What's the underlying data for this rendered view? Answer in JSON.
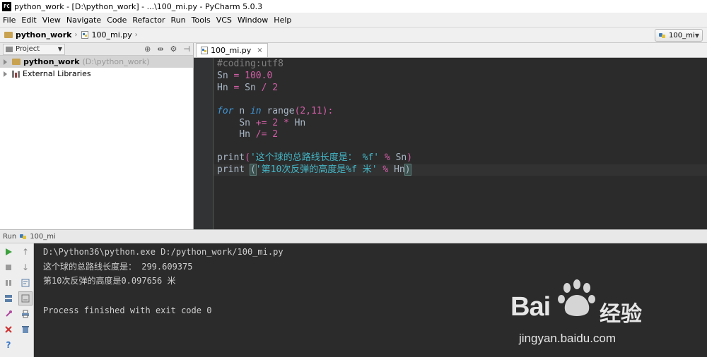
{
  "window": {
    "title": "python_work - [D:\\python_work] - ...\\100_mi.py - PyCharm 5.0.3",
    "app_icon": "PC"
  },
  "menu": [
    "File",
    "Edit",
    "View",
    "Navigate",
    "Code",
    "Refactor",
    "Run",
    "Tools",
    "VCS",
    "Window",
    "Help"
  ],
  "breadcrumb": {
    "project": "python_work",
    "file": "100_mi.py"
  },
  "run_config": {
    "label": "100_mi"
  },
  "project_panel": {
    "view_label": "Project",
    "tree": [
      {
        "label": "python_work",
        "path": "(D:\\python_work)",
        "icon": "folder-icon"
      },
      {
        "label": "External Libraries",
        "path": "",
        "icon": "libraries-icon"
      }
    ]
  },
  "editor": {
    "tab_label": "100_mi.py",
    "tab_close": "×",
    "lines": [
      "#coding:utf8",
      "Sn = 100.0",
      "Hn = Sn / 2",
      "",
      "for n in range(2,11):",
      "    Sn += 2 * Hn",
      "    Hn /= 2",
      "",
      "print('这个球的总路线长度是： %f' % Sn)",
      "print ('第10次反弹的高度是%f 米' % Hn)"
    ]
  },
  "run_panel": {
    "label": "Run",
    "config": "100_mi",
    "output": [
      "D:\\Python36\\python.exe D:/python_work/100_mi.py",
      "这个球的总路线长度是： 299.609375",
      "第10次反弹的高度是0.097656 米",
      "",
      "Process finished with exit code 0"
    ]
  },
  "watermark": {
    "brand": "Bai",
    "brand2": "经验",
    "url": "jingyan.baidu.com"
  },
  "colors": {
    "editor_bg": "#2b2b2b",
    "keyword": "#cc7832",
    "number": "#6897bb",
    "comment": "#808080",
    "string": "#44b5c5"
  }
}
